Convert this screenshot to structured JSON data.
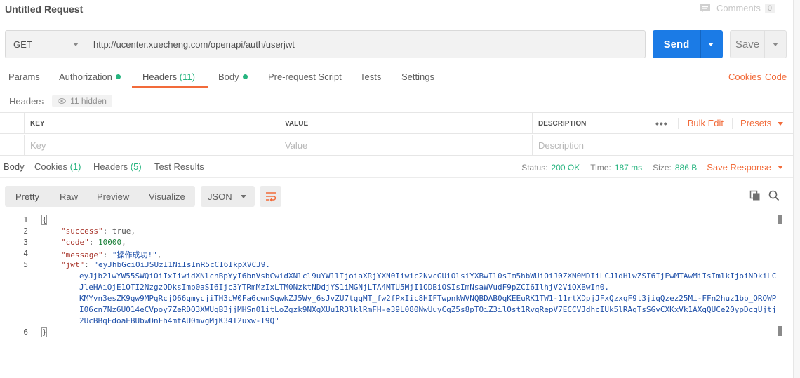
{
  "title": "Untitled Request",
  "comments": {
    "label": "Comments",
    "count": "0"
  },
  "request": {
    "method": "GET",
    "url": "http://ucenter.xuecheng.com/openapi/auth/userjwt",
    "send_label": "Send",
    "save_label": "Save"
  },
  "request_tabs": {
    "params": "Params",
    "authorization": "Authorization",
    "headers": "Headers",
    "headers_count": "(11)",
    "body": "Body",
    "pre_request": "Pre-request Script",
    "tests": "Tests",
    "settings": "Settings",
    "cookies": "Cookies",
    "code": "Code"
  },
  "headers_section": {
    "label": "Headers",
    "hidden": "11 hidden"
  },
  "kv_table": {
    "columns": [
      "KEY",
      "VALUE",
      "DESCRIPTION"
    ],
    "placeholders": [
      "Key",
      "Value",
      "Description"
    ],
    "more": "•••",
    "bulk_edit": "Bulk Edit",
    "presets": "Presets"
  },
  "response_tabs": {
    "body": "Body",
    "cookies": "Cookies",
    "cookies_count": "(1)",
    "headers": "Headers",
    "headers_count": "(5)",
    "test_results": "Test Results"
  },
  "response_status": {
    "status_label": "Status:",
    "status_value": "200 OK",
    "time_label": "Time:",
    "time_value": "187 ms",
    "size_label": "Size:",
    "size_value": "886 B",
    "save_response": "Save Response"
  },
  "format_bar": {
    "modes": [
      "Pretty",
      "Raw",
      "Preview",
      "Visualize"
    ],
    "active_mode": "Pretty",
    "language": "JSON"
  },
  "code": {
    "line_numbers": [
      "1",
      "2",
      "3",
      "4",
      "5",
      "6"
    ],
    "open_brace": "{",
    "close_brace": "}",
    "success_key": "\"success\"",
    "success_value": "true",
    "code_key": "\"code\"",
    "code_value": "10000",
    "message_key": "\"message\"",
    "message_value": "\"操作成功!\"",
    "jwt_key": "\"jwt\"",
    "jwt_lines": [
      "\"eyJhbGciOiJSUzI1NiIsInR5cCI6IkpXVCJ9.",
      "eyJjb21wYW55SWQiOiIxIiwidXNlcnBpYyI6bnVsbCwidXNlcl9uYW1lIjoiaXRjYXN0Iiwic2NvcGUiOlsiYXBwIl0sIm5hbWUiOiJ0ZXN0MDIiLCJ1dHlwZSI6IjEwMTAwMiIsImlkIjoiNDkiLC",
      "JleHAiOjE1OTI2NzgzODksImp0aSI6Ijc3YTRmMzIxLTM0NzktNDdjYS1iMGNjLTA4MTU5MjI1ODBiOSIsImNsaWVudF9pZCI6IlhjV2ViQXBwIn0.",
      "KMYvn3esZK9gw9MPgRcjO66qmycjiTH3cW0Fa6cwnSqwkZJ5Wy_6sJvZU7tgqMT_fw2fPxIic8HIFTwpnkWVNQBDAB0qKEEuRK1TW1-11rtXDpjJFxQzxqF9t3jiqQzez25Mi-FFn2huz1bb_OROWP",
      "I06cn7Nz6U014eCVpoy7ZeRDO3XWUqB3jjMHSn01itLoZgzk9NXgXUu1R3lklRmFH-e39L080NwUuyCqZ5s8pTOiZ3ilOst1RvgRepV7ECCVJdhcIUk5lRAqTsSGvCXKxVk1AXqQUCe20ypDcgUjtj",
      "2UcBBqFdoaEBUbwDnFh4mtAU0mvgMjK34T2uxw-T9Q\""
    ]
  },
  "colors": {
    "accent": "#f26b3a",
    "send": "#1b7be6",
    "success": "#26b47f"
  }
}
